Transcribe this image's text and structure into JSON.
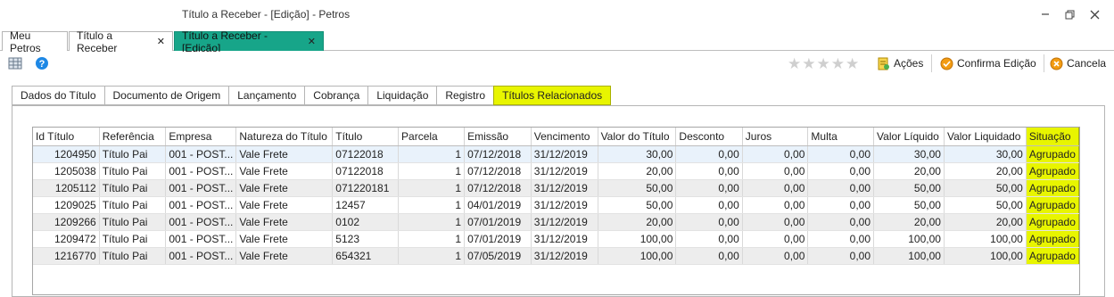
{
  "window": {
    "title": "Título a Receber - [Edição] - Petros"
  },
  "doc_tabs": [
    {
      "label": "Meu Petros"
    },
    {
      "label": "Título a Receber"
    },
    {
      "label": "Título a Receber - [Edição]"
    }
  ],
  "toolbar": {
    "acoes_label": "Ações",
    "confirma_label": "Confirma Edição",
    "cancela_label": "Cancela",
    "rating_stars": 5
  },
  "page_tabs": [
    {
      "label": "Dados do Título"
    },
    {
      "label": "Documento de Origem"
    },
    {
      "label": "Lançamento"
    },
    {
      "label": "Cobrança"
    },
    {
      "label": "Liquidação"
    },
    {
      "label": "Registro"
    },
    {
      "label": "Títulos Relacionados"
    }
  ],
  "colors": {
    "accent_teal": "#17a589",
    "highlight_yellow": "#e8f500"
  },
  "grid": {
    "columns": [
      "Id Título",
      "Referência",
      "Empresa",
      "Natureza do Título",
      "Título",
      "Parcela",
      "Emissão",
      "Vencimento",
      "Valor do Título",
      "Desconto",
      "Juros",
      "Multa",
      "Valor Líquido",
      "Valor Liquidado",
      "Situação"
    ],
    "rows": [
      [
        "1204950",
        "Título Pai",
        "001 - POST...",
        "Vale Frete",
        "07122018",
        "1",
        "07/12/2018",
        "31/12/2019",
        "30,00",
        "0,00",
        "0,00",
        "0,00",
        "30,00",
        "30,00",
        "Agrupado"
      ],
      [
        "1205038",
        "Título Pai",
        "001 - POST...",
        "Vale Frete",
        "07122018",
        "1",
        "07/12/2018",
        "31/12/2019",
        "20,00",
        "0,00",
        "0,00",
        "0,00",
        "20,00",
        "20,00",
        "Agrupado"
      ],
      [
        "1205112",
        "Título Pai",
        "001 - POST...",
        "Vale Frete",
        "071220181",
        "1",
        "07/12/2018",
        "31/12/2019",
        "50,00",
        "0,00",
        "0,00",
        "0,00",
        "50,00",
        "50,00",
        "Agrupado"
      ],
      [
        "1209025",
        "Título Pai",
        "001 - POST...",
        "Vale Frete",
        "12457",
        "1",
        "04/01/2019",
        "31/12/2019",
        "50,00",
        "0,00",
        "0,00",
        "0,00",
        "50,00",
        "50,00",
        "Agrupado"
      ],
      [
        "1209266",
        "Título Pai",
        "001 - POST...",
        "Vale Frete",
        "0102",
        "1",
        "07/01/2019",
        "31/12/2019",
        "20,00",
        "0,00",
        "0,00",
        "0,00",
        "20,00",
        "20,00",
        "Agrupado"
      ],
      [
        "1209472",
        "Título Pai",
        "001 - POST...",
        "Vale Frete",
        "5123",
        "1",
        "07/01/2019",
        "31/12/2019",
        "100,00",
        "0,00",
        "0,00",
        "0,00",
        "100,00",
        "100,00",
        "Agrupado"
      ],
      [
        "1216770",
        "Título Pai",
        "001 - POST...",
        "Vale Frete",
        "654321",
        "1",
        "07/05/2019",
        "31/12/2019",
        "100,00",
        "0,00",
        "0,00",
        "0,00",
        "100,00",
        "100,00",
        "Agrupado"
      ]
    ]
  }
}
